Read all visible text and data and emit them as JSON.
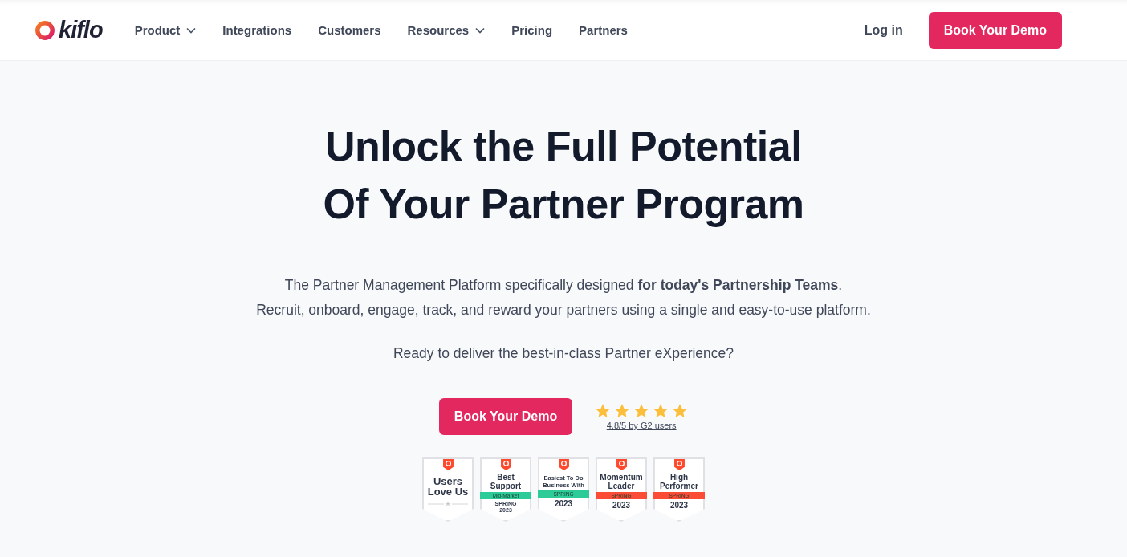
{
  "header": {
    "logo": "kiflo",
    "nav": [
      {
        "label": "Product",
        "dropdown": true
      },
      {
        "label": "Integrations",
        "dropdown": false
      },
      {
        "label": "Customers",
        "dropdown": false
      },
      {
        "label": "Resources",
        "dropdown": true
      },
      {
        "label": "Pricing",
        "dropdown": false
      },
      {
        "label": "Partners",
        "dropdown": false
      }
    ],
    "login": "Log in",
    "cta": "Book Your Demo"
  },
  "hero": {
    "title_lines": [
      "Unlock the Full Potential",
      "Of Your Partner Program"
    ],
    "lead": [
      "The Partner Management Platform specifically designed **for today's Partnership Teams**.",
      "Recruit, onboard, engage, track, and reward your partners using a single and easy-to-use platform."
    ],
    "question": "Ready to deliver the best-in-class Partner eXperience?",
    "cta": "Book Your Demo",
    "rating": {
      "stars": 5,
      "label": "4.8/5 by G2 users"
    },
    "badges": [
      {
        "kind": "plain",
        "title": "Users Love Us"
      },
      {
        "kind": "ribbon",
        "title": "Best Support",
        "ribbon": "Mid-Market",
        "color": "#2ccb98",
        "footer": [
          "SPRING",
          "2023"
        ]
      },
      {
        "kind": "ribbon",
        "title": "Easiest To Do Business With",
        "ribbon": "SPRING",
        "color": "#2ccb98",
        "footer": [
          "2023"
        ]
      },
      {
        "kind": "ribbon",
        "title": "Momentum Leader",
        "ribbon": "SPRING",
        "color": "#fb4d35",
        "footer": [
          "2023"
        ]
      },
      {
        "kind": "ribbon",
        "title": "High Performer",
        "ribbon": "SPRING",
        "color": "#fb4d35",
        "footer": [
          "2023"
        ]
      }
    ]
  }
}
